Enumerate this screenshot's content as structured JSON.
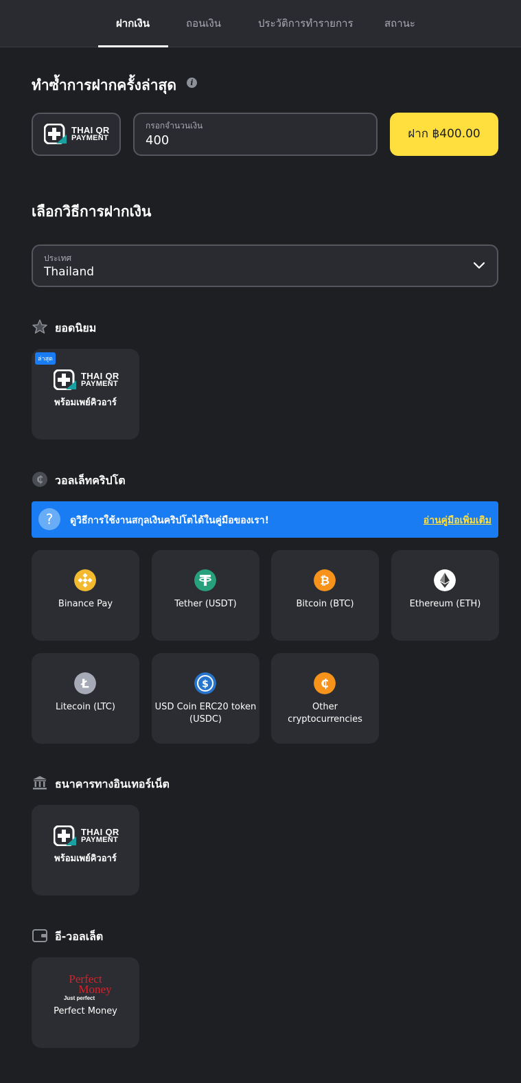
{
  "tabs": [
    {
      "label": "ฝากเงิน"
    },
    {
      "label": "ถอนเงิน"
    },
    {
      "label": "ประวัติการทำรายการ"
    },
    {
      "label": "สถานะ"
    }
  ],
  "repeat": {
    "title": "ทำซ้ำการฝากครั้งล่าสุด",
    "qr_line1": "THAI QR",
    "qr_line2": "PAYMENT",
    "amount_label": "กรอกจำนวนเงิน",
    "amount_value": "400",
    "deposit_button": "ฝาก ฿400.00"
  },
  "method": {
    "title": "เลือกวิธีการฝากเงิน",
    "country_label": "ประเทศ",
    "country_value": "Thailand"
  },
  "popular": {
    "title": "ยอดนิยม",
    "card": {
      "badge": "ล่าสุด",
      "qr_line1": "THAI QR",
      "qr_line2": "PAYMENT",
      "label": "พร้อมเพย์คิวอาร์"
    }
  },
  "crypto": {
    "title": "วอลเล็ทคริปโต",
    "banner_text": "ดูวิธีการใช้งานสกุลเงินคริปโตได้ในคู่มือของเรา!",
    "banner_link": "อ่านคู่มือเพิ่มเติม",
    "items": [
      {
        "label": "Binance Pay",
        "icon": "binance-icon",
        "color": "#f3ba2f"
      },
      {
        "label": "Tether (USDT)",
        "icon": "tether-icon",
        "color": "#26a17b"
      },
      {
        "label": "Bitcoin (BTC)",
        "icon": "bitcoin-icon",
        "color": "#f7931a"
      },
      {
        "label": "Ethereum (ETH)",
        "icon": "ethereum-icon",
        "color": "#ffffff"
      },
      {
        "label": "Litecoin (LTC)",
        "icon": "litecoin-icon",
        "color": "#a6a9b6"
      },
      {
        "label": "USD Coin ERC20 token (USDC)",
        "icon": "usdc-icon",
        "color": "#2775ca"
      },
      {
        "label": "Other cryptocurrencies",
        "icon": "other-crypto-icon",
        "color": "#f7931a"
      }
    ]
  },
  "bank": {
    "title": "ธนาคารทางอินเทอร์เน็ต",
    "card": {
      "qr_line1": "THAI QR",
      "qr_line2": "PAYMENT",
      "label": "พร้อมเพย์คิวอาร์"
    }
  },
  "ewallet": {
    "title": "อี-วอลเล็ต",
    "card": {
      "logo_line1": "Perfect",
      "logo_line2": "Money",
      "logo_tagline": "Just perfect",
      "label": "Perfect Money"
    }
  },
  "colors": {
    "accent": "#ffdf3d",
    "banner": "#1a7cf2",
    "background": "#1e1f23",
    "card": "#2c2d32"
  }
}
